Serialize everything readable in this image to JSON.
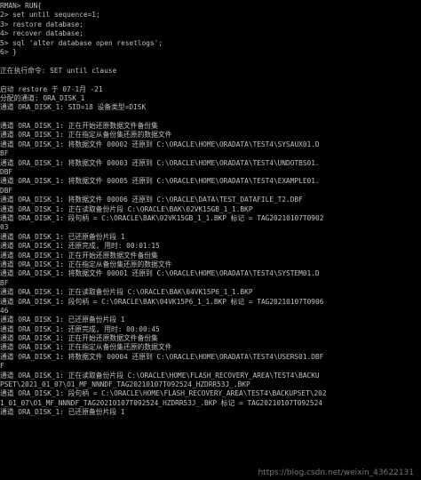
{
  "console": {
    "lines": [
      "RMAN> RUN{",
      "2> set until sequence=1;",
      "3> restore database;",
      "4> recover database;",
      "5> sql 'alter database open resetlogs';",
      "6> }",
      "",
      "正在执行命令: SET until clause",
      "",
      "启动 restore 于 07-1月 -21",
      "分配的通道: ORA_DISK_1",
      "通道 ORA_DISK_1: SID=18 设备类型=DISK",
      "",
      "通道 ORA_DISK_1: 正在开始还原数据文件备份集",
      "通道 ORA_DISK_1: 正在指定从备份集还原的数据文件",
      "通道 ORA_DISK_1: 将数据文件 00002 还原到 C:\\ORACLE\\HOME\\ORADATA\\TEST4\\SYSAUX01.D",
      "BF",
      "通道 ORA_DISK_1: 将数据文件 00003 还原到 C:\\ORACLE\\HOME\\ORADATA\\TEST4\\UNDOTBS01.",
      "DBF",
      "通道 ORA_DISK_1: 将数据文件 00005 还原到 C:\\ORACLE\\HOME\\ORADATA\\TEST4\\EXAMPLE01.",
      "DBF",
      "通道 ORA_DISK_1: 将数据文件 00006 还原到 C:\\ORACLE\\DATA\\TEST_DATAFILE_T2.DBF",
      "通道 ORA_DISK_1: 正在读取备份片段 C:\\ORACLE\\BAK\\02VK15GB_1_1.BKP",
      "通道 ORA_DISK_1: 段句柄 = C:\\ORACLE\\BAK\\02VK15GB_1_1.BKP 标记 = TAG20210107T0902",
      "03",
      "通道 ORA_DISK_1: 已还原备份片段 1",
      "通道 ORA_DISK_1: 还原完成, 用时: 00:01:15",
      "通道 ORA_DISK_1: 正在开始还原数据文件备份集",
      "通道 ORA_DISK_1: 正在指定从备份集还原的数据文件",
      "通道 ORA_DISK_1: 将数据文件 00001 还原到 C:\\ORACLE\\HOME\\ORADATA\\TEST4\\SYSTEM01.D",
      "BF",
      "通道 ORA_DISK_1: 正在读取备份片段 C:\\ORACLE\\BAK\\04VK15P6_1_1.BKP",
      "通道 ORA_DISK_1: 段句柄 = C:\\ORACLE\\BAK\\04VK15P6_1_1.BKP 标记 = TAG20210107T0906",
      "46",
      "通道 ORA_DISK_1: 已还原备份片段 1",
      "通道 ORA_DISK_1: 还原完成, 用时: 00:00:45",
      "通道 ORA_DISK_1: 正在开始还原数据文件备份集",
      "通道 ORA_DISK_1: 正在指定从备份集还原的数据文件",
      "通道 ORA_DISK_1: 将数据文件 00004 还原到 C:\\ORACLE\\HOME\\ORADATA\\TEST4\\USERS01.DBF",
      "F",
      "通道 ORA_DISK_1: 正在读取备份片段 C:\\ORACLE\\HOME\\FLASH_RECOVERY_AREA\\TEST4\\BACKU",
      "PSET\\2021_01_07\\O1_MF_NNNDF_TAG20210107T092524_HZDRR53J_.BKP",
      "通道 ORA_DISK_1: 段句柄 = C:\\ORACLE\\HOME\\FLASH_RECOVERY_AREA\\TEST4\\BACKUPSET\\202",
      "1_01_07\\O1_MF_NNNDF_TAG20210107T092524_HZDRR53J_.BKP 标记 = TAG20210107T092524",
      "通道 ORA_DISK_1: 已还原备份片段 1"
    ]
  },
  "watermark": {
    "text": "https://blog.csdn.net/weixin_43622131"
  },
  "colors": {
    "background": "#000000",
    "text": "#c0c0c0"
  }
}
